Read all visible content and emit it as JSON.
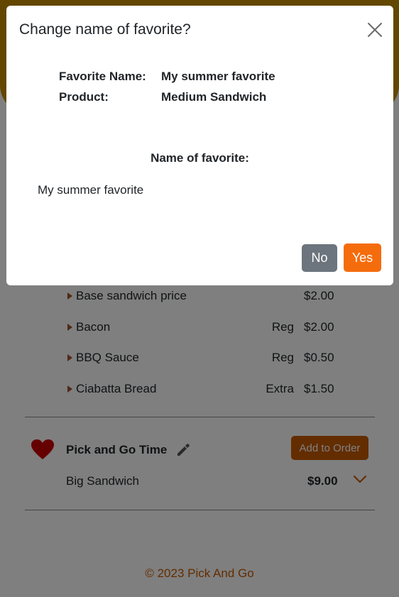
{
  "background": {
    "line_items": [
      {
        "name": "Base sandwich price",
        "size": "",
        "price": "$2.00"
      },
      {
        "name": "Bacon",
        "size": "Reg",
        "price": "$2.00"
      },
      {
        "name": "BBQ Sauce",
        "size": "Reg",
        "price": "$0.50"
      },
      {
        "name": "Ciabatta Bread",
        "size": "Extra",
        "price": "$1.50"
      }
    ],
    "favorite": {
      "title": "Pick and Go Time",
      "product": "Big Sandwich",
      "price": "$9.00",
      "add_button": "Add to Order"
    },
    "footer": "© 2023 Pick And Go"
  },
  "modal": {
    "title": "Change name of favorite?",
    "favorite_name_label": "Favorite Name:",
    "favorite_name_value": "My summer favorite",
    "product_label": "Product:",
    "product_value": "Medium Sandwich",
    "name_field_label": "Name of favorite:",
    "name_field_value": "My summer favorite",
    "no_button": "No",
    "yes_button": "Yes"
  },
  "colors": {
    "accent": "#f56c0c",
    "banner": "#c78f00",
    "heart": "#cc0000"
  },
  "icons": [
    "close-icon",
    "heart-icon",
    "pencil-icon",
    "chevron-down-icon",
    "caret-right-icon"
  ]
}
